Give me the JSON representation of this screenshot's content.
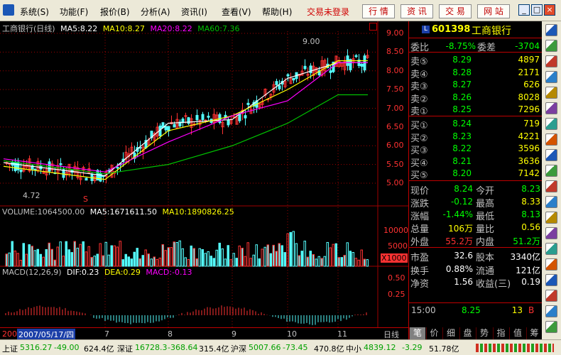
{
  "menubar": {
    "items": [
      "系统(S)",
      "功能(F)",
      "报价(B)",
      "分析(A)",
      "资讯(I)",
      "查看(V)",
      "帮助(H)"
    ],
    "login_status": "交易未登录",
    "buttons": [
      "行 情",
      "资 讯",
      "交 易",
      "网 站"
    ]
  },
  "chart": {
    "title": "工商银行(日线)",
    "ma_labels": [
      "MA5:8.22",
      "MA10:8.27",
      "MA20:8.22",
      "MA60:7.36"
    ],
    "high_marker": "9.00",
    "low_marker": "4.72",
    "s_marker": "S",
    "volume_label": "VOLUME:1064500.00",
    "vol_ma5": "MA5:1671611.50",
    "vol_ma10": "MA10:1890826.25",
    "macd_label": "MACD(12,26,9)",
    "dif": "DIF:0.23",
    "dea": "DEA:0.29",
    "macd_val": "MACD:-0.13",
    "date_prefix": "200",
    "date_highlight": "2007/05/17/四",
    "period_label": "日线",
    "x_labels": [
      "7",
      "8",
      "9",
      "10",
      "11"
    ],
    "price_axis": [
      "9.00",
      "8.50",
      "8.00",
      "7.50",
      "7.00",
      "6.50",
      "6.00",
      "5.50",
      "5.00"
    ],
    "vol_axis": [
      "10000",
      "5000",
      "X1000"
    ],
    "macd_axis": [
      "0.50",
      "0.25"
    ],
    "colors": {
      "up": "#ff3232",
      "down": "#54fcfc",
      "ma5": "#ffffff",
      "ma10": "#ffff00",
      "ma20": "#ff00ff",
      "ma60": "#00c000",
      "grid": "#a00000"
    }
  },
  "chart_data": [
    {
      "type": "line",
      "title": "工商银行(日线)",
      "x": [
        "7",
        "8",
        "9",
        "10",
        "11"
      ],
      "series": [
        {
          "name": "MA5",
          "values": [
            5.2,
            6.6,
            6.7,
            7.8,
            8.22
          ]
        },
        {
          "name": "MA10",
          "values": [
            5.1,
            6.4,
            6.8,
            7.5,
            8.27
          ]
        },
        {
          "name": "MA20",
          "values": [
            5.3,
            6.1,
            6.8,
            7.2,
            8.22
          ]
        },
        {
          "name": "MA60",
          "values": [
            5.25,
            5.5,
            6.0,
            6.6,
            7.36
          ]
        }
      ],
      "ylim": [
        4.72,
        9.0
      ]
    }
  ],
  "quote": {
    "code": "601398",
    "name": "工商银行",
    "weibi_label": "委比",
    "weibi": "-8.75%",
    "weicha_label": "委差",
    "weicha": "-3704",
    "sell": [
      {
        "label": "卖⑤",
        "price": "8.29",
        "vol": "4897"
      },
      {
        "label": "卖④",
        "price": "8.28",
        "vol": "2171"
      },
      {
        "label": "卖③",
        "price": "8.27",
        "vol": "626"
      },
      {
        "label": "卖②",
        "price": "8.26",
        "vol": "8028"
      },
      {
        "label": "卖①",
        "price": "8.25",
        "vol": "7296"
      }
    ],
    "buy": [
      {
        "label": "买①",
        "price": "8.24",
        "vol": "719"
      },
      {
        "label": "买②",
        "price": "8.23",
        "vol": "4221"
      },
      {
        "label": "买③",
        "price": "8.22",
        "vol": "3596"
      },
      {
        "label": "买④",
        "price": "8.21",
        "vol": "3636"
      },
      {
        "label": "买⑤",
        "price": "8.20",
        "vol": "7142"
      }
    ],
    "stats": [
      {
        "l1": "现价",
        "v1": "8.24",
        "c1": "#00ff00",
        "l2": "今开",
        "v2": "8.23",
        "c2": "#00ff00"
      },
      {
        "l1": "涨跌",
        "v1": "-0.12",
        "c1": "#00ff00",
        "l2": "最高",
        "v2": "8.33",
        "c2": "#ffff00"
      },
      {
        "l1": "涨幅",
        "v1": "-1.44%",
        "c1": "#00ff00",
        "l2": "最低",
        "v2": "8.13",
        "c2": "#00ff00"
      },
      {
        "l1": "总量",
        "v1": "106万",
        "c1": "#ffff00",
        "l2": "量比",
        "v2": "0.56",
        "c2": "#ffff00"
      },
      {
        "l1": "外盘",
        "v1": "55.2万",
        "c1": "#ff3232",
        "l2": "内盘",
        "v2": "51.2万",
        "c2": "#00ff00"
      }
    ],
    "fund": [
      {
        "l1": "市盈",
        "v1": "32.6",
        "l2": "股本",
        "v2": "3340亿"
      },
      {
        "l1": "换手",
        "v1": "0.88%",
        "l2": "流通",
        "v2": "121亿"
      },
      {
        "l1": "净资",
        "v1": "1.56",
        "l2": "收益(三)",
        "v2": "0.19"
      }
    ],
    "trade": {
      "time": "15:00",
      "price": "8.25",
      "vol": "13",
      "dir": "B"
    },
    "tabs": [
      "笔",
      "价",
      "细",
      "盘",
      "势",
      "指",
      "值",
      "筹"
    ]
  },
  "status": {
    "sh_label": "上证",
    "sh_val": "5316.27",
    "sh_chg": "-49.00",
    "sh_amt": "624.4亿",
    "sz_label": "深证",
    "sz_val": "16728.3",
    "sz_chg": "-368.64",
    "sz_amt": "315.4亿",
    "hs_label": "沪深",
    "hs_val": "5007.66",
    "hs_chg": "-73.45",
    "hs_amt": "470.8亿",
    "zx_label": "中小",
    "zx_val": "4839.12",
    "zx_chg": "-3.29",
    "zx_amt": "51.78亿"
  }
}
